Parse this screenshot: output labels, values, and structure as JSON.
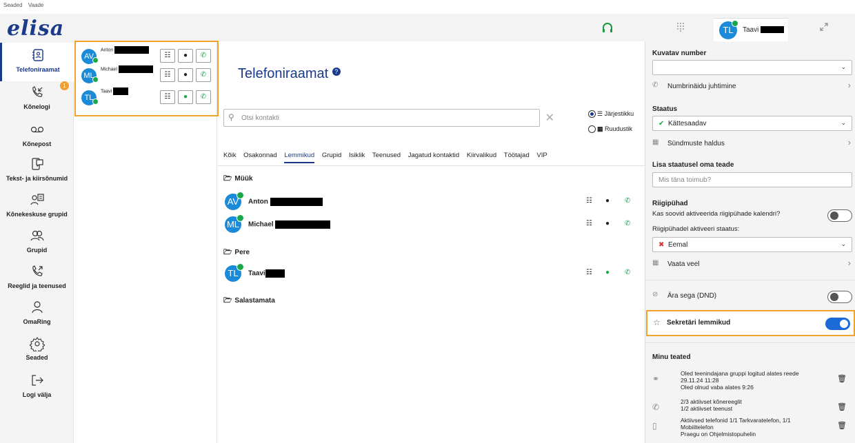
{
  "menubar": {
    "items": [
      "Seaded",
      "Vaade"
    ]
  },
  "brand": {
    "logo": "elisa",
    "color": "#1c3a8a"
  },
  "header": {
    "user_initials": "TL",
    "user_name": "Taavi"
  },
  "nav": {
    "items": [
      {
        "label": "Telefoniraamat",
        "icon": "address-book-icon",
        "active": true
      },
      {
        "label": "Kõnelogi",
        "icon": "call-log-icon",
        "badge": "1"
      },
      {
        "label": "Kõnepost",
        "icon": "voicemail-icon"
      },
      {
        "label": "Tekst- ja kiirsõnumid",
        "icon": "message-icon"
      },
      {
        "label": "Kõnekeskuse grupid",
        "icon": "call-center-icon"
      },
      {
        "label": "Grupid",
        "icon": "groups-icon"
      },
      {
        "label": "Reeglid ja teenused",
        "icon": "rules-icon"
      },
      {
        "label": "OmaRing",
        "icon": "person-icon"
      },
      {
        "label": "Seaded",
        "icon": "gear-icon"
      },
      {
        "label": "Logi välja",
        "icon": "logout-icon"
      }
    ]
  },
  "favorites": [
    {
      "initials": "AV",
      "name": "Anton"
    },
    {
      "initials": "ML",
      "name": "Michael"
    },
    {
      "initials": "TL",
      "name": "Taavi"
    }
  ],
  "main": {
    "title": "Telefoniraamat",
    "search_placeholder": "Otsi kontakti",
    "view_list": "Järjestikku",
    "view_grid": "Ruudustik",
    "tabs": [
      "Kõik",
      "Osakonnad",
      "Lemmikud",
      "Grupid",
      "Isiklik",
      "Teenused",
      "Jagatud kontaktid",
      "Kiirvalikud",
      "Töötajad",
      "VIP"
    ],
    "active_tab": "Lemmikud",
    "groups": [
      {
        "name": "Müük",
        "contacts": [
          {
            "initials": "AV",
            "name": "Anton"
          },
          {
            "initials": "ML",
            "name": "Michael"
          }
        ]
      },
      {
        "name": "Pere",
        "contacts": [
          {
            "initials": "TL",
            "name": "Taavi"
          }
        ]
      },
      {
        "name": "Salastamata",
        "contacts": []
      }
    ]
  },
  "right_panel": {
    "display_number_label": "Kuvatav number",
    "display_number_value": "",
    "numbers_link": "Numbrinäidu juhtimine",
    "status_label": "Staatus",
    "status_value": "Kättesaadav",
    "events_link": "Sündmuste haldus",
    "status_message_label": "Lisa staatusel oma teade",
    "status_message_placeholder": "Mis täna toimub?",
    "holidays_label": "Riigipühad",
    "holidays_question": "Kas soovid aktiveerida riigipühade kalendri?",
    "holidays_status_label": "Riigipühadel aktiveeri staatus:",
    "holidays_status_value": "Eemal",
    "see_more_link": "Vaata veel",
    "dnd_label": "Ära sega (DND)",
    "secretary_label": "Sekretäri lemmikud",
    "my_notices_label": "Minu teated",
    "notices": [
      {
        "icon": "headset-icon",
        "lines": [
          "Oled teenindajana gruppi logitud alates reede",
          "29.11.24 11:28",
          "Oled olnud vaba alates 9:26"
        ]
      },
      {
        "icon": "call-forward-icon",
        "lines": [
          "2/3 aktiivset kõnereeglit",
          "1/2 aktiivset teenust"
        ]
      },
      {
        "icon": "mobile-icon",
        "lines": [
          "Aktiivsed telefonid 1/1 Tarkvaratelefon, 1/1",
          "Mobiiltelefon",
          "Praegu on Ohjelmistopuhelin"
        ]
      }
    ]
  },
  "colors": {
    "accent": "#1c3a8a",
    "avatar": "#1b8ad8",
    "online": "#18a84a",
    "highlight": "#f2a12a",
    "toggle_on": "#1c6ad8"
  }
}
